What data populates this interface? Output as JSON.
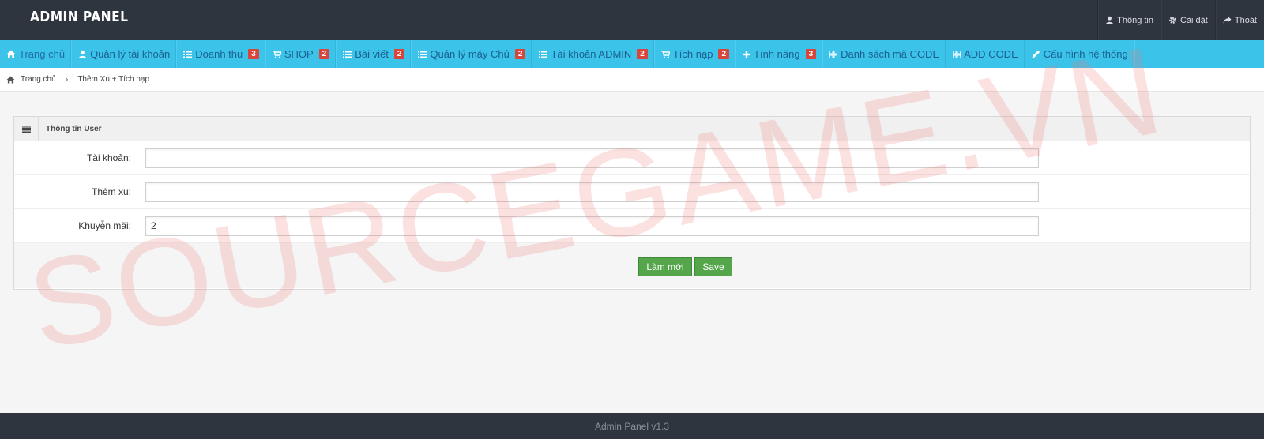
{
  "header": {
    "brand": "ADMIN PANEL",
    "actions": [
      {
        "label": "Thông tin",
        "icon": "user-icon"
      },
      {
        "label": "Cài đặt",
        "icon": "gear-icon"
      },
      {
        "label": "Thoát",
        "icon": "share-icon"
      }
    ]
  },
  "nav": {
    "items": [
      {
        "label": "Trang chủ",
        "icon": "home-icon"
      },
      {
        "label": "Quản lý tài khoản",
        "icon": "user-icon"
      },
      {
        "label": "Doanh thu",
        "icon": "list-icon",
        "badge": "3"
      },
      {
        "label": "SHOP",
        "icon": "cart-icon",
        "badge": "2"
      },
      {
        "label": "Bài viết",
        "icon": "list-icon",
        "badge": "2"
      },
      {
        "label": "Quản lý máy Chủ",
        "icon": "list-icon",
        "badge": "2"
      },
      {
        "label": "Tài khoản ADMIN",
        "icon": "list-icon",
        "badge": "2"
      },
      {
        "label": "Tích nạp",
        "icon": "cart-icon",
        "badge": "2"
      },
      {
        "label": "Tính năng",
        "icon": "plus-icon",
        "badge": "3"
      },
      {
        "label": "Danh sách mã CODE",
        "icon": "grid-icon"
      },
      {
        "label": "ADD CODE",
        "icon": "grid-icon"
      },
      {
        "label": "Cấu hình hệ thống",
        "icon": "pencil-icon"
      }
    ]
  },
  "breadcrumb": {
    "home": "Trang chủ",
    "current": "Thêm Xu + Tích nạp"
  },
  "panel": {
    "title": "Thông tin User",
    "fields": [
      {
        "label": "Tài khoản:",
        "value": ""
      },
      {
        "label": "Thêm xu:",
        "value": ""
      },
      {
        "label": "Khuyễn mãi:",
        "value": "2"
      }
    ],
    "reset_label": "Làm mới",
    "save_label": "Save"
  },
  "watermark": "SOURCEGAME.VN",
  "footer": "Admin Panel v1.3",
  "colors": {
    "topbar": "#2e353f",
    "navbar": "#3cc3ea",
    "badge": "#d9453b",
    "button": "#55a64b"
  }
}
